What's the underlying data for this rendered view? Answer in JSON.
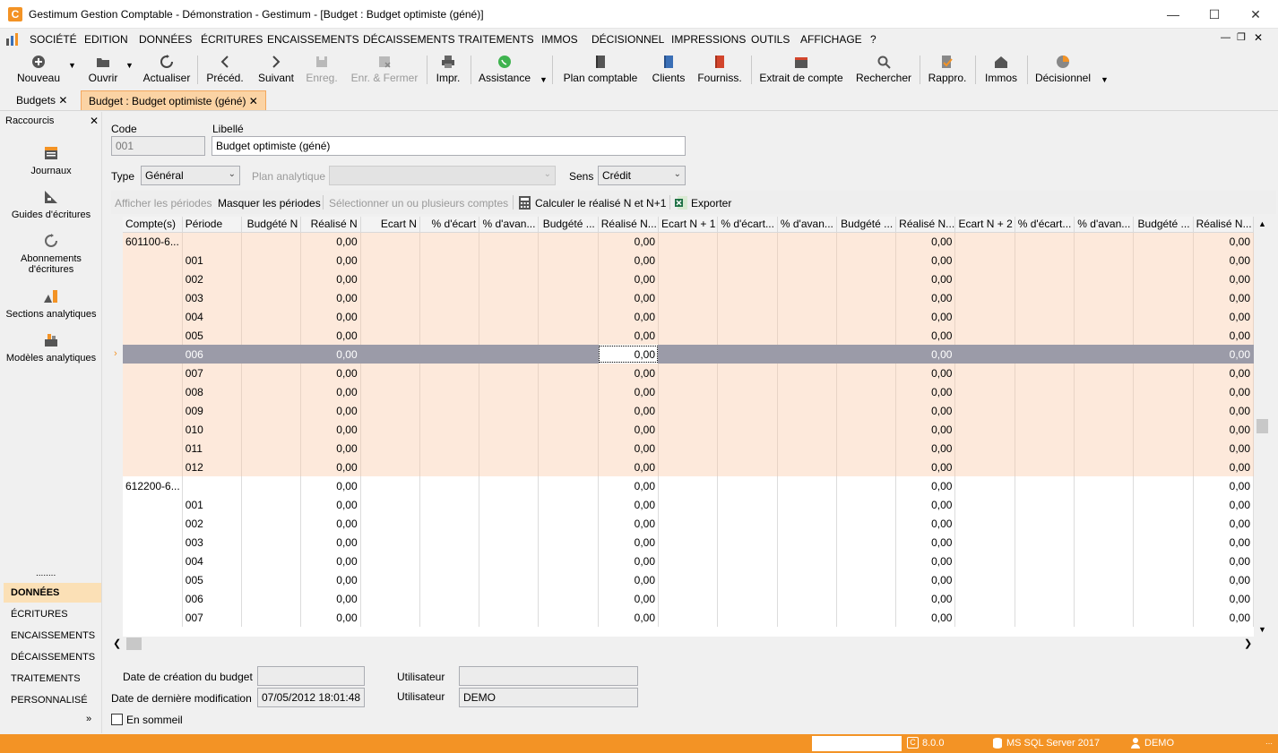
{
  "window": {
    "title": "Gestimum Gestion Comptable - Démonstration - Gestimum - [Budget : Budget optimiste (géné)]"
  },
  "menu": [
    "SOCIÉTÉ",
    "EDITION",
    "DONNÉES",
    "ÉCRITURES",
    "ENCAISSEMENTS",
    "DÉCAISSEMENTS",
    "TRAITEMENTS",
    "IMMOS",
    "DÉCISIONNEL",
    "IMPRESSIONS",
    "OUTILS",
    "AFFICHAGE",
    "?"
  ],
  "toolbar": {
    "nouveau": "Nouveau",
    "ouvrir": "Ouvrir",
    "actualiser": "Actualiser",
    "preced": "Précéd.",
    "suivant": "Suivant",
    "enreg": "Enreg.",
    "enr_fermer": "Enr. & Fermer",
    "impr": "Impr.",
    "assistance": "Assistance",
    "plan_comptable": "Plan comptable",
    "clients": "Clients",
    "fourniss": "Fourniss.",
    "extrait": "Extrait de compte",
    "rechercher": "Rechercher",
    "rappro": "Rappro.",
    "immos": "Immos",
    "decisionnel": "Décisionnel"
  },
  "tabs": {
    "budgets": "Budgets",
    "budget_active": "Budget : Budget optimiste (géné)"
  },
  "sidebar": {
    "title": "Raccourcis",
    "shortcuts": [
      "Journaux",
      "Guides d'écritures",
      "Abonnements d'écritures",
      "Sections analytiques",
      "Modèles analytiques"
    ],
    "nav": [
      "DONNÉES",
      "ÉCRITURES",
      "ENCAISSEMENTS",
      "DÉCAISSEMENTS",
      "TRAITEMENTS",
      "PERSONNALISÉ"
    ],
    "dots": "........"
  },
  "form": {
    "code_label": "Code",
    "code_value": "001",
    "libelle_label": "Libellé",
    "libelle_value": "Budget optimiste (géné)",
    "type_label": "Type",
    "type_value": "Général",
    "plan_label": "Plan analytique",
    "plan_value": "",
    "sens_label": "Sens",
    "sens_value": "Crédit"
  },
  "actions": {
    "afficher": "Afficher les périodes",
    "masquer": "Masquer les périodes",
    "selectionner": "Sélectionner un ou plusieurs comptes",
    "calculer": "Calculer le réalisé N et N+1",
    "exporter": "Exporter"
  },
  "grid": {
    "columns": [
      "Compte(s)",
      "Période",
      "Budgété N",
      "Réalisé N",
      "Ecart N",
      "% d'écart",
      "% d'avan...",
      "Budgété ...",
      "Réalisé N...",
      "Ecart N + 1",
      "% d'écart...",
      "% d'avan...",
      "Budgété ...",
      "Réalisé N...",
      "Ecart N + 2",
      "% d'écart...",
      "% d'avan...",
      "Budgété ...",
      "Réalisé N..."
    ],
    "rows": [
      {
        "g": "a",
        "c": "601100-6...",
        "p": "",
        "v": [
          "",
          "0,00",
          "",
          "",
          "",
          "",
          "0,00",
          "",
          "",
          "",
          "",
          "0,00",
          "",
          "",
          "",
          "",
          "0,00"
        ]
      },
      {
        "g": "a",
        "c": "",
        "p": "001",
        "v": [
          "",
          "0,00",
          "",
          "",
          "",
          "",
          "0,00",
          "",
          "",
          "",
          "",
          "0,00",
          "",
          "",
          "",
          "",
          "0,00"
        ]
      },
      {
        "g": "a",
        "c": "",
        "p": "002",
        "v": [
          "",
          "0,00",
          "",
          "",
          "",
          "",
          "0,00",
          "",
          "",
          "",
          "",
          "0,00",
          "",
          "",
          "",
          "",
          "0,00"
        ]
      },
      {
        "g": "a",
        "c": "",
        "p": "003",
        "v": [
          "",
          "0,00",
          "",
          "",
          "",
          "",
          "0,00",
          "",
          "",
          "",
          "",
          "0,00",
          "",
          "",
          "",
          "",
          "0,00"
        ]
      },
      {
        "g": "a",
        "c": "",
        "p": "004",
        "v": [
          "",
          "0,00",
          "",
          "",
          "",
          "",
          "0,00",
          "",
          "",
          "",
          "",
          "0,00",
          "",
          "",
          "",
          "",
          "0,00"
        ]
      },
      {
        "g": "a",
        "c": "",
        "p": "005",
        "v": [
          "",
          "0,00",
          "",
          "",
          "",
          "",
          "0,00",
          "",
          "",
          "",
          "",
          "0,00",
          "",
          "",
          "",
          "",
          "0,00"
        ]
      },
      {
        "g": "s",
        "c": "",
        "p": "006",
        "v": [
          "",
          "0,00",
          "",
          "",
          "",
          "",
          "0,00",
          "",
          "",
          "",
          "",
          "0,00",
          "",
          "",
          "",
          "",
          "0,00"
        ]
      },
      {
        "g": "a",
        "c": "",
        "p": "007",
        "v": [
          "",
          "0,00",
          "",
          "",
          "",
          "",
          "0,00",
          "",
          "",
          "",
          "",
          "0,00",
          "",
          "",
          "",
          "",
          "0,00"
        ]
      },
      {
        "g": "a",
        "c": "",
        "p": "008",
        "v": [
          "",
          "0,00",
          "",
          "",
          "",
          "",
          "0,00",
          "",
          "",
          "",
          "",
          "0,00",
          "",
          "",
          "",
          "",
          "0,00"
        ]
      },
      {
        "g": "a",
        "c": "",
        "p": "009",
        "v": [
          "",
          "0,00",
          "",
          "",
          "",
          "",
          "0,00",
          "",
          "",
          "",
          "",
          "0,00",
          "",
          "",
          "",
          "",
          "0,00"
        ]
      },
      {
        "g": "a",
        "c": "",
        "p": "010",
        "v": [
          "",
          "0,00",
          "",
          "",
          "",
          "",
          "0,00",
          "",
          "",
          "",
          "",
          "0,00",
          "",
          "",
          "",
          "",
          "0,00"
        ]
      },
      {
        "g": "a",
        "c": "",
        "p": "011",
        "v": [
          "",
          "0,00",
          "",
          "",
          "",
          "",
          "0,00",
          "",
          "",
          "",
          "",
          "0,00",
          "",
          "",
          "",
          "",
          "0,00"
        ]
      },
      {
        "g": "a",
        "c": "",
        "p": "012",
        "v": [
          "",
          "0,00",
          "",
          "",
          "",
          "",
          "0,00",
          "",
          "",
          "",
          "",
          "0,00",
          "",
          "",
          "",
          "",
          "0,00"
        ]
      },
      {
        "g": "b",
        "c": "612200-6...",
        "p": "",
        "v": [
          "",
          "0,00",
          "",
          "",
          "",
          "",
          "0,00",
          "",
          "",
          "",
          "",
          "0,00",
          "",
          "",
          "",
          "",
          "0,00"
        ]
      },
      {
        "g": "b",
        "c": "",
        "p": "001",
        "v": [
          "",
          "0,00",
          "",
          "",
          "",
          "",
          "0,00",
          "",
          "",
          "",
          "",
          "0,00",
          "",
          "",
          "",
          "",
          "0,00"
        ]
      },
      {
        "g": "b",
        "c": "",
        "p": "002",
        "v": [
          "",
          "0,00",
          "",
          "",
          "",
          "",
          "0,00",
          "",
          "",
          "",
          "",
          "0,00",
          "",
          "",
          "",
          "",
          "0,00"
        ]
      },
      {
        "g": "b",
        "c": "",
        "p": "003",
        "v": [
          "",
          "0,00",
          "",
          "",
          "",
          "",
          "0,00",
          "",
          "",
          "",
          "",
          "0,00",
          "",
          "",
          "",
          "",
          "0,00"
        ]
      },
      {
        "g": "b",
        "c": "",
        "p": "004",
        "v": [
          "",
          "0,00",
          "",
          "",
          "",
          "",
          "0,00",
          "",
          "",
          "",
          "",
          "0,00",
          "",
          "",
          "",
          "",
          "0,00"
        ]
      },
      {
        "g": "b",
        "c": "",
        "p": "005",
        "v": [
          "",
          "0,00",
          "",
          "",
          "",
          "",
          "0,00",
          "",
          "",
          "",
          "",
          "0,00",
          "",
          "",
          "",
          "",
          "0,00"
        ]
      },
      {
        "g": "b",
        "c": "",
        "p": "006",
        "v": [
          "",
          "0,00",
          "",
          "",
          "",
          "",
          "0,00",
          "",
          "",
          "",
          "",
          "0,00",
          "",
          "",
          "",
          "",
          "0,00"
        ]
      },
      {
        "g": "b",
        "c": "",
        "p": "007",
        "v": [
          "",
          "0,00",
          "",
          "",
          "",
          "",
          "0,00",
          "",
          "",
          "",
          "",
          "0,00",
          "",
          "",
          "",
          "",
          "0,00"
        ]
      }
    ]
  },
  "footer": {
    "date_creation_label": "Date de création du budget",
    "date_creation_value": "",
    "date_modif_label": "Date de dernière modification",
    "date_modif_value": "07/05/2012 18:01:48",
    "utilisateur_label_1": "Utilisateur",
    "utilisateur_value_1": "",
    "utilisateur_label_2": "Utilisateur",
    "utilisateur_value_2": "DEMO",
    "en_sommeil": "En sommeil"
  },
  "status": {
    "version": "8.0.0",
    "server": "MS SQL Server 2017",
    "user": "DEMO"
  },
  "colors": {
    "accent": "#f39325",
    "row_highlight": "#fde9db",
    "selected_row": "#9b9ba8"
  }
}
